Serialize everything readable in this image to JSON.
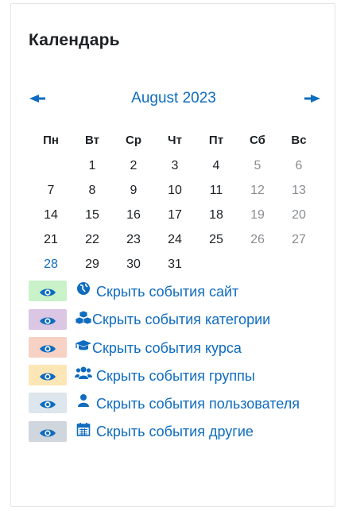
{
  "title": "Календарь",
  "nav": {
    "prev_icon": "arrow-left-icon",
    "next_icon": "arrow-right-icon",
    "month": "August 2023"
  },
  "weekdays": [
    "Пн",
    "Вт",
    "Ср",
    "Чт",
    "Пт",
    "Сб",
    "Вс"
  ],
  "weeks": [
    [
      "",
      "1",
      "2",
      "3",
      "4",
      "5",
      "6"
    ],
    [
      "7",
      "8",
      "9",
      "10",
      "11",
      "12",
      "13"
    ],
    [
      "14",
      "15",
      "16",
      "17",
      "18",
      "19",
      "20"
    ],
    [
      "21",
      "22",
      "23",
      "24",
      "25",
      "26",
      "27"
    ],
    [
      "28",
      "29",
      "30",
      "31",
      "",
      "",
      ""
    ]
  ],
  "today": "28",
  "legend": [
    {
      "label": "Скрыть события сайт",
      "icon": "globe-icon",
      "color": "#c9f2c9"
    },
    {
      "label": "Скрыть события категории",
      "icon": "cubes-icon",
      "color": "#dbc6e3"
    },
    {
      "label": "Скрыть события курса",
      "icon": "graduation-cap-icon",
      "color": "#f7d1c3"
    },
    {
      "label": "Скрыть события группы",
      "icon": "users-icon",
      "color": "#fde6b5"
    },
    {
      "label": "Скрыть события пользователя",
      "icon": "user-icon",
      "color": "#dde6ec"
    },
    {
      "label": "Скрыть события другие",
      "icon": "calendar-icon",
      "color": "#cfd6dd"
    }
  ],
  "colors": {
    "link": "#0f6cbf",
    "weekend": "#8a8d91"
  }
}
